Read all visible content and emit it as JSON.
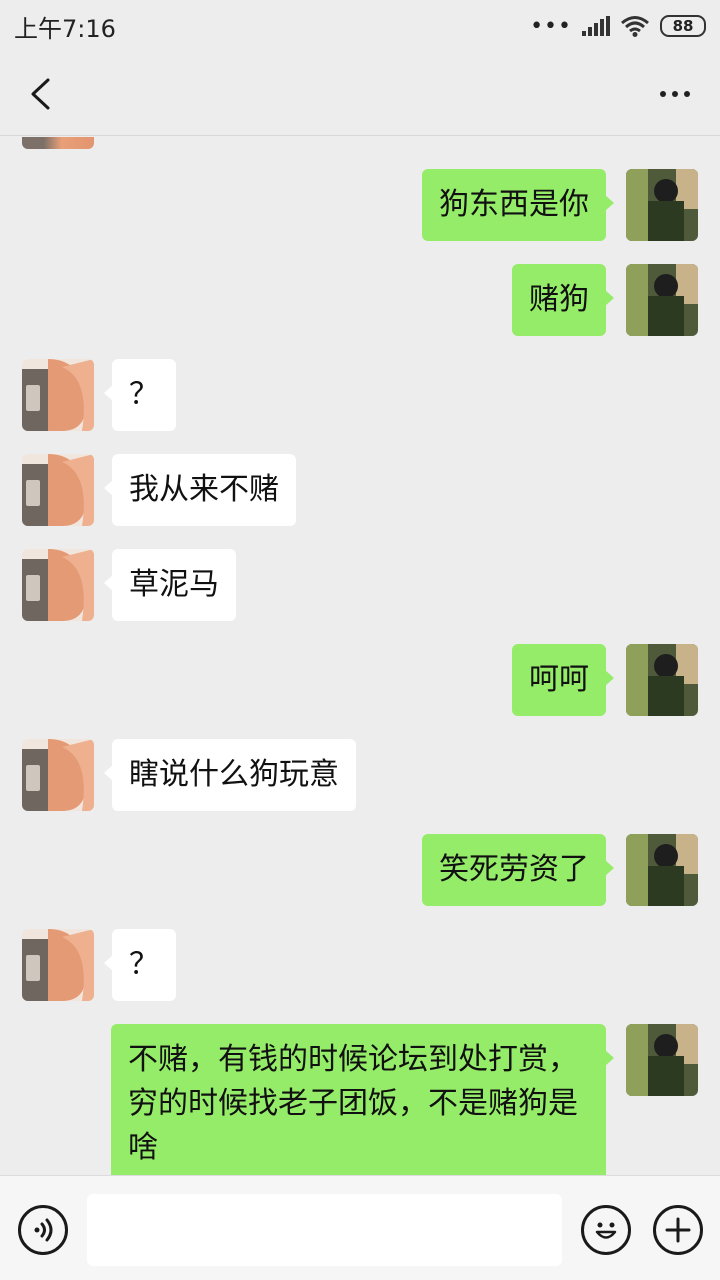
{
  "status_bar": {
    "time": "上午7:16",
    "dots": "•••",
    "battery": "88"
  },
  "header": {
    "back_icon": "chevron-left-icon",
    "more_icon": "more-dots-icon"
  },
  "messages": [
    {
      "side": "right",
      "text": "狗东西是你"
    },
    {
      "side": "right",
      "text": "赌狗"
    },
    {
      "side": "left",
      "text": "？"
    },
    {
      "side": "left",
      "text": "我从来不赌"
    },
    {
      "side": "left",
      "text": "草泥马"
    },
    {
      "side": "right",
      "text": "呵呵"
    },
    {
      "side": "left",
      "text": "瞎说什么狗玩意"
    },
    {
      "side": "right",
      "text": "笑死劳资了"
    },
    {
      "side": "left",
      "text": "？"
    },
    {
      "side": "right",
      "text": "不赌，有钱的时候论坛到处打赏，穷的时候找老子团饭，不是赌狗是啥"
    }
  ],
  "input_bar": {
    "voice_icon": "voice-icon",
    "emoji_icon": "emoji-icon",
    "plus_icon": "plus-icon",
    "text_value": ""
  },
  "colors": {
    "self_bubble": "#95ec69",
    "other_bubble": "#ffffff",
    "background": "#ededed"
  }
}
